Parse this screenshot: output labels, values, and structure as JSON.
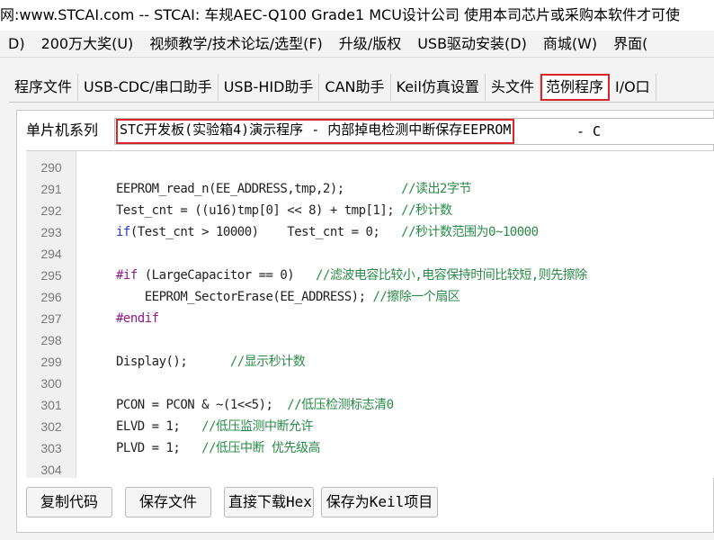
{
  "title_bar": {
    "text": "网:www.STCAI.com  -- STCAI: 车规AEC-Q100 Grade1 MCU设计公司 使用本司芯片或采购本软件才可使"
  },
  "menu": {
    "items": [
      "D)",
      "200万大奖(U)",
      "视频教学/技术论坛/选型(F)",
      "升级/版权",
      "USB驱动安装(D)",
      "商城(W)",
      "界面("
    ]
  },
  "tabs": {
    "items": [
      "程序文件",
      "USB-CDC/串口助手",
      "USB-HID助手",
      "CAN助手",
      "Keil仿真设置",
      "头文件",
      "范例程序",
      "I/O口"
    ],
    "active": "范例程序"
  },
  "series": {
    "label": "单片机系列",
    "value": "STC开发板(实验箱4)演示程序 - 内部掉电检测中断保存EEPROM",
    "suffix": "- C"
  },
  "code_lines": [
    {
      "no": "290",
      "parts": []
    },
    {
      "no": "291",
      "parts": [
        [
          "t",
          "EEPROM_read_n(EE_ADDRESS,tmp,2);        "
        ],
        [
          "cm",
          "//读出2字节"
        ]
      ]
    },
    {
      "no": "292",
      "parts": [
        [
          "t",
          "Test_cnt = ((u16)tmp[0] << 8) + tmp[1]; "
        ],
        [
          "cm",
          "//秒计数"
        ]
      ]
    },
    {
      "no": "293",
      "parts": [
        [
          "kw",
          "if"
        ],
        [
          "t",
          "(Test_cnt > 10000)    Test_cnt = 0;   "
        ],
        [
          "cm",
          "//秒计数范围为0~10000"
        ]
      ]
    },
    {
      "no": "294",
      "parts": []
    },
    {
      "no": "295",
      "parts": [
        [
          "pp",
          "#if"
        ],
        [
          "t",
          " (LargeCapacitor == 0)   "
        ],
        [
          "cm",
          "//滤波电容比较小,电容保持时间比较短,则先擦除"
        ]
      ]
    },
    {
      "no": "296",
      "parts": [
        [
          "t",
          "    EEPROM_SectorErase(EE_ADDRESS); "
        ],
        [
          "cm",
          "//擦除一个扇区"
        ]
      ]
    },
    {
      "no": "297",
      "parts": [
        [
          "pp",
          "#endif"
        ]
      ]
    },
    {
      "no": "298",
      "parts": []
    },
    {
      "no": "299",
      "parts": [
        [
          "t",
          "Display();      "
        ],
        [
          "cm",
          "//显示秒计数"
        ]
      ]
    },
    {
      "no": "300",
      "parts": []
    },
    {
      "no": "301",
      "parts": [
        [
          "t",
          "PCON = PCON & ~(1<<5);  "
        ],
        [
          "cm",
          "//低压检测标志清0"
        ]
      ]
    },
    {
      "no": "302",
      "parts": [
        [
          "t",
          "ELVD = 1;   "
        ],
        [
          "cm",
          "//低压监测中断允许"
        ]
      ]
    },
    {
      "no": "303",
      "parts": [
        [
          "t",
          "PLVD = 1;   "
        ],
        [
          "cm",
          "//低压中断 优先级高"
        ]
      ]
    },
    {
      "no": "304",
      "parts": []
    }
  ],
  "buttons": {
    "copy": "复制代码",
    "save_file": "保存文件",
    "download_hex": "直接下载Hex",
    "save_keil": "保存为Keil项目"
  },
  "colors": {
    "highlight_red": "#d9252a",
    "keyword_blue": "#1a3fd0",
    "comment_green": "#2a8a48",
    "preprocessor_purple": "#8b1a8b"
  }
}
